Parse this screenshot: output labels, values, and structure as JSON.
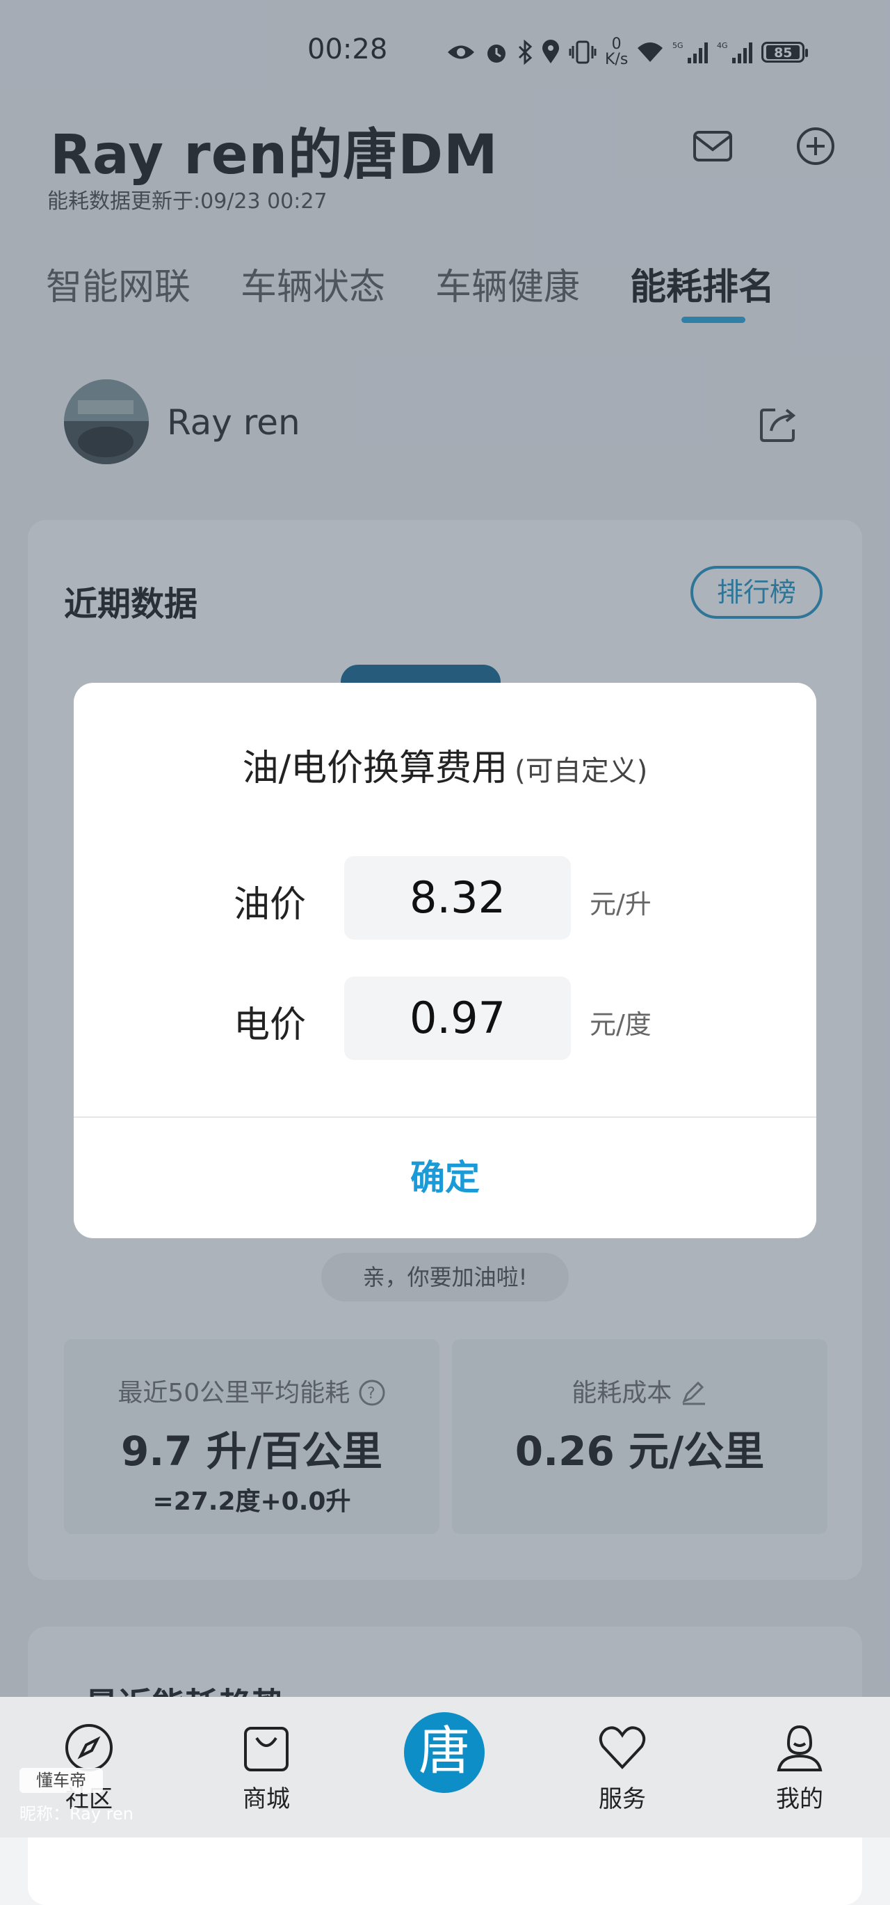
{
  "status_bar": {
    "time": "00:28",
    "net_speed_value": "0",
    "net_speed_unit": "K/s",
    "net_5g": "5G",
    "net_4g": "4G",
    "battery": "85"
  },
  "header": {
    "title": "Ray ren的唐DM",
    "updated": "能耗数据更新于:09/23 00:27",
    "icons": [
      "mail-icon",
      "add-circle-icon"
    ]
  },
  "tabs": [
    "智能网联",
    "车辆状态",
    "车辆健康",
    "能耗排名"
  ],
  "active_tab": "能耗排名",
  "accent_color": "#1da0dc",
  "profile": {
    "name": "Ray ren"
  },
  "recent_card": {
    "title": "近期数据",
    "rank_button": "排行榜",
    "refuel_tip": "亲，你要加油啦!",
    "avg_label": "最近50公里平均能耗",
    "avg_value": "9.7 升/百公里",
    "avg_sub": "=27.2度+0.0升",
    "cost_label": "能耗成本",
    "cost_value": "0.26 元/公里"
  },
  "trend_card": {
    "title": "最近能耗趋势"
  },
  "dialog": {
    "title": "油/电价换算费用",
    "title_hint": "(可自定义)",
    "oil_label": "油价",
    "oil_value": "8.32",
    "oil_unit": "元/升",
    "elec_label": "电价",
    "elec_value": "0.97",
    "elec_unit": "元/度",
    "confirm": "确定"
  },
  "bottom_nav": {
    "items": [
      {
        "label": "社区",
        "icon": "compass-icon"
      },
      {
        "label": "商城",
        "icon": "shopping-bag-icon"
      },
      {
        "label": "唐",
        "icon": "center-logo"
      },
      {
        "label": "服务",
        "icon": "heart-icon"
      },
      {
        "label": "我的",
        "icon": "user-icon"
      }
    ]
  },
  "watermark": {
    "logo": "懂车帝",
    "nickname": "昵称：Ray ren"
  }
}
